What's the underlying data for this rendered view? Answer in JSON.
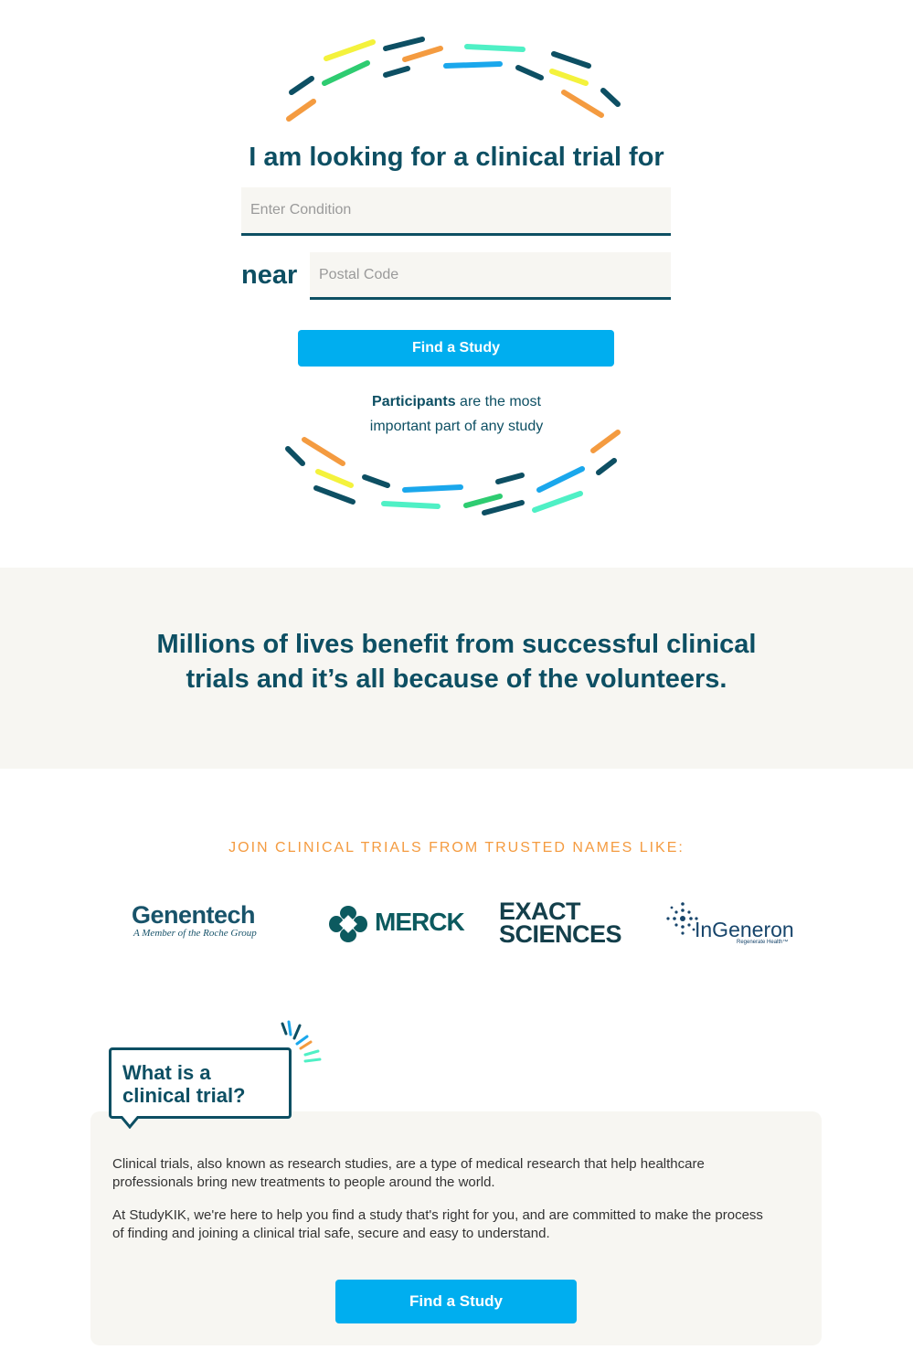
{
  "search": {
    "headline": "I am looking for a clinical trial for",
    "condition_placeholder": "Enter Condition",
    "near_label": "near",
    "postal_placeholder": "Postal Code",
    "find_button_label": "Find a Study",
    "participants_bold": "Participants",
    "participants_rest_1": " are the most",
    "participants_rest_2": "important part of any study"
  },
  "band": {
    "line1": "Millions of lives benefit from successful clinical",
    "line2": "trials and it’s all because of the volunteers."
  },
  "trusted": {
    "heading": "JOIN CLINICAL TRIALS FROM TRUSTED NAMES LIKE:",
    "logos": {
      "genentech": "Genentech",
      "genentech_sub": "A Member of the Roche Group",
      "merck": "MERCK",
      "exact_line1": "EXACT",
      "exact_line2": "SCIENCES",
      "ingeneron": "InGeneron",
      "ingeneron_sub": "Regenerate Health™"
    }
  },
  "info": {
    "title_line1": "What is a",
    "title_line2": "clinical trial?",
    "para1": "Clinical trials, also known as research studies, are a type of medical research that help healthcare professionals bring new treatments to people around the world.",
    "para2": "At StudyKIK, we're here to help you find a study that's right for you, and are committed to make the process of finding and joining a clinical trial safe, secure and easy to understand.",
    "find_button_label": "Find a Study"
  },
  "colors": {
    "navy": "#0d4f63",
    "accent_blue": "#00aeef",
    "orange": "#f49b40",
    "panel": "#f7f6f2",
    "yellow": "#f4f23c",
    "green": "#2ecc71",
    "mint": "#4ff0c5",
    "sky": "#1aa7ec"
  }
}
